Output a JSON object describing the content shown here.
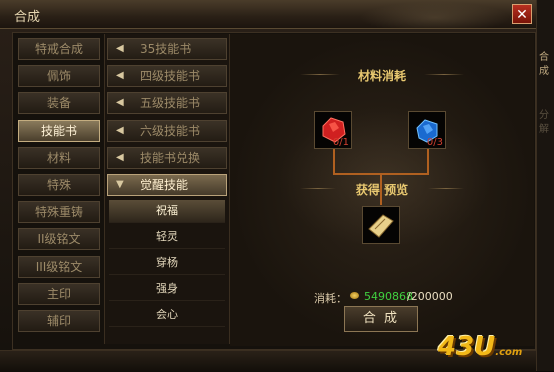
{
  "window": {
    "title": "合成"
  },
  "right_strip": {
    "items": [
      "合",
      "成",
      "分",
      "解"
    ]
  },
  "categories": [
    "特戒合成",
    "佩饰",
    "装备",
    "技能书",
    "材料",
    "特殊",
    "特殊重铸",
    "II级铭文",
    "III级铭文",
    "主印",
    "辅印"
  ],
  "active_category": "技能书",
  "books": [
    {
      "label": "35技能书"
    },
    {
      "label": "四级技能书"
    },
    {
      "label": "五级技能书"
    },
    {
      "label": "六级技能书"
    },
    {
      "label": "技能书兑换"
    },
    {
      "label": "觉醒技能"
    }
  ],
  "sub_items": [
    "祝福",
    "轻灵",
    "穿杨",
    "强身",
    "会心"
  ],
  "selected_sub": "祝福",
  "content": {
    "materials_title": "材料消耗",
    "material_1": {
      "icon": "red-gem-icon",
      "count": "0/1"
    },
    "material_2": {
      "icon": "blue-gem-icon",
      "count": "0/3"
    },
    "result_title": "获得 预览",
    "result": {
      "icon": "skill-book-icon"
    },
    "cost_label": "消耗：",
    "cost_have": "5490868",
    "cost_need": "/200000",
    "make_button": "合 成"
  },
  "colors": {
    "gold_title": "#e8c870",
    "have_green": "#40d040",
    "missing_red": "#d04030"
  },
  "watermark": {
    "text": "43U",
    "suffix": ".com"
  }
}
